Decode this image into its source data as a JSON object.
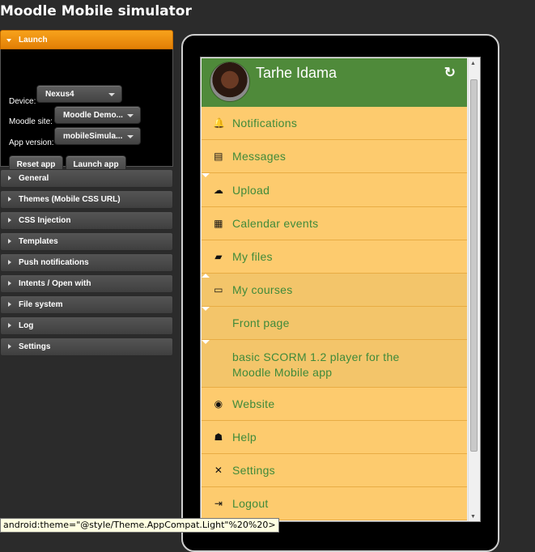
{
  "app": {
    "title": "Moodle Mobile simulator"
  },
  "launch": {
    "header": "Launch",
    "device_label": "Device:",
    "device_value": "Nexus4",
    "site_label": "Moodle site:",
    "site_value": "Moodle Demo...",
    "version_label": "App version:",
    "version_value": "mobileSimula...",
    "reset_label": "Reset app",
    "launch_label": "Launch app"
  },
  "sections": [
    "General",
    "Themes (Mobile CSS URL)",
    "CSS Injection",
    "Templates",
    "Push notifications",
    "Intents / Open with",
    "File system",
    "Log",
    "Settings"
  ],
  "profile": {
    "name": "Tarhe Idama",
    "refresh_icon": "refresh-icon"
  },
  "menu": [
    {
      "label": "Notifications",
      "icon": "bell-icon"
    },
    {
      "label": "Messages",
      "icon": "messages-icon"
    },
    {
      "label": "Upload",
      "icon": "upload-cloud-icon"
    },
    {
      "label": "Calendar events",
      "icon": "calendar-icon"
    },
    {
      "label": "My files",
      "icon": "folder-icon"
    },
    {
      "label": "My courses",
      "icon": "courses-icon"
    },
    {
      "label": "Front page",
      "icon": ""
    },
    {
      "label": "basic SCORM 1.2 player for the Moodle Mobile app",
      "icon": ""
    },
    {
      "label": "Website",
      "icon": "website-icon"
    },
    {
      "label": "Help",
      "icon": "help-icon"
    },
    {
      "label": "Settings",
      "icon": "tools-icon"
    },
    {
      "label": "Logout",
      "icon": "logout-icon"
    }
  ],
  "tooltip": "android:theme=\"@style/Theme.AppCompat.Light\"%20%20>",
  "colors": {
    "accent": "#f39414",
    "profile_bg": "#4f8a3a",
    "menu_bg": "#fdcb6e",
    "menu_text": "#3f8a3a"
  }
}
